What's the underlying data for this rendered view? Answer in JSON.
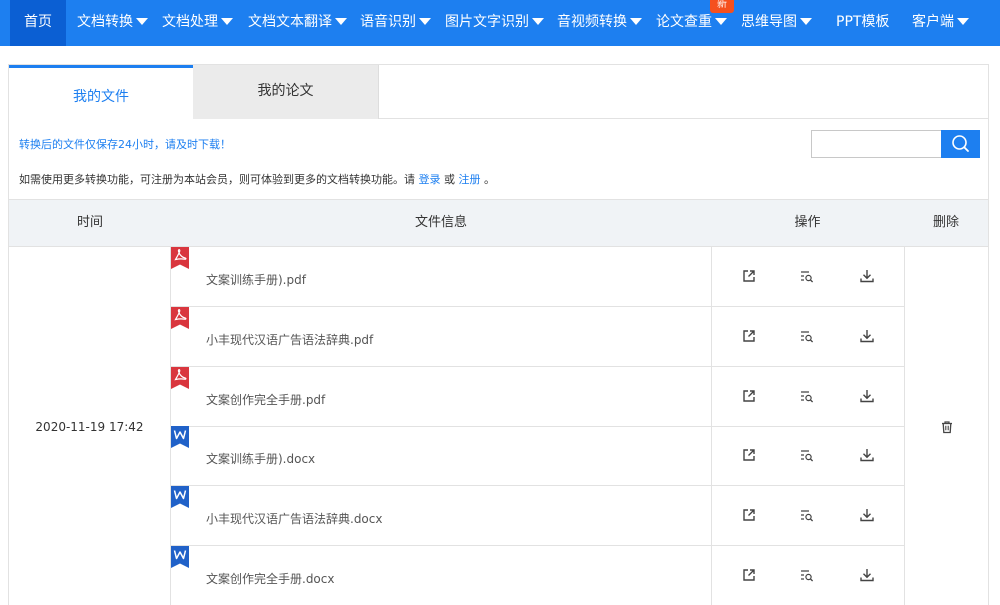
{
  "nav": {
    "items": [
      {
        "label": "首页",
        "caret": false,
        "active": true
      },
      {
        "label": "文档转换",
        "caret": true
      },
      {
        "label": "文档处理",
        "caret": true
      },
      {
        "label": "文档文本翻译",
        "caret": true
      },
      {
        "label": "语音识别",
        "caret": true
      },
      {
        "label": "图片文字识别",
        "caret": true
      },
      {
        "label": "音视频转换",
        "caret": true
      },
      {
        "label": "论文查重",
        "caret": true
      },
      {
        "label": "思维导图",
        "caret": true
      },
      {
        "label": "PPT模板",
        "caret": false
      },
      {
        "label": "客户端",
        "caret": true
      }
    ],
    "new_badge": "新",
    "accent": "#1d7ff0"
  },
  "tabs": [
    {
      "label": "我的文件",
      "active": true
    },
    {
      "label": "我的论文",
      "active": false
    }
  ],
  "notice": {
    "retention": "转换后的文件仅保存24小时，请及时下载！",
    "register_prefix": "如需使用更多转换功能，可注册为本站会员，则可体验到更多的文档转换功能。请",
    "login_link": "登录",
    "or": "或",
    "register_link": "注册",
    "suffix": "。"
  },
  "search": {
    "placeholder": "",
    "icon": "search-icon"
  },
  "table": {
    "headers": {
      "time": "时间",
      "file_info": "文件信息",
      "actions": "操作",
      "delete": "删除"
    },
    "time": "2020-11-19 17:42",
    "files": [
      {
        "name": "文案训练手册).pdf",
        "type": "pdf"
      },
      {
        "name": "小丰现代汉语广告语法辞典.pdf",
        "type": "pdf"
      },
      {
        "name": "文案创作完全手册.pdf",
        "type": "pdf"
      },
      {
        "name": "文案训练手册).docx",
        "type": "word"
      },
      {
        "name": "小丰现代汉语广告语法辞典.docx",
        "type": "word"
      },
      {
        "name": "文案创作完全手册.docx",
        "type": "word"
      }
    ],
    "action_icons": [
      "open-external-icon",
      "preview-icon",
      "download-icon"
    ],
    "delete_icon": "trash-icon"
  },
  "colors": {
    "pdf": "#d9363e",
    "word": "#2061c8",
    "header_bg": "#f0f3f6"
  }
}
